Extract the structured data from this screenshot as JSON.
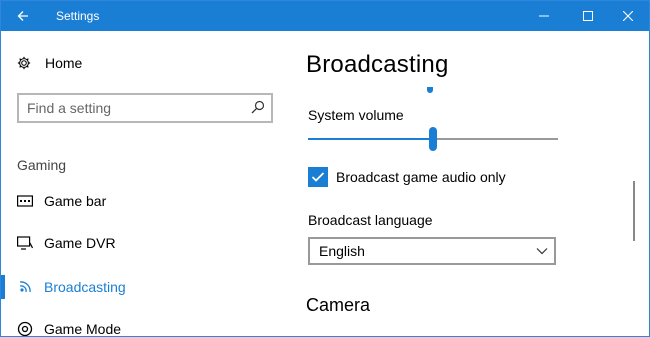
{
  "window": {
    "title": "Settings",
    "accent": "#1a7fd4"
  },
  "titlebar": {
    "back_icon": "back-arrow-icon",
    "minimize_icon": "minimize-icon",
    "maximize_icon": "maximize-icon",
    "close_icon": "close-icon"
  },
  "sidebar": {
    "home_label": "Home",
    "search": {
      "placeholder": "Find a setting",
      "value": ""
    },
    "section_label": "Gaming",
    "items": [
      {
        "label": "Game bar",
        "icon": "game-bar-icon",
        "active": false
      },
      {
        "label": "Game DVR",
        "icon": "game-dvr-icon",
        "active": false
      },
      {
        "label": "Broadcasting",
        "icon": "broadcasting-icon",
        "active": true
      },
      {
        "label": "Game Mode",
        "icon": "game-mode-icon",
        "active": false
      }
    ]
  },
  "main": {
    "title": "Broadcasting",
    "system_volume": {
      "label": "System volume",
      "level_fraction": 0.5
    },
    "broadcast_audio_only": {
      "label": "Broadcast game audio only",
      "checked": true
    },
    "broadcast_language": {
      "label": "Broadcast language",
      "selected": "English"
    },
    "camera_heading": "Camera"
  }
}
